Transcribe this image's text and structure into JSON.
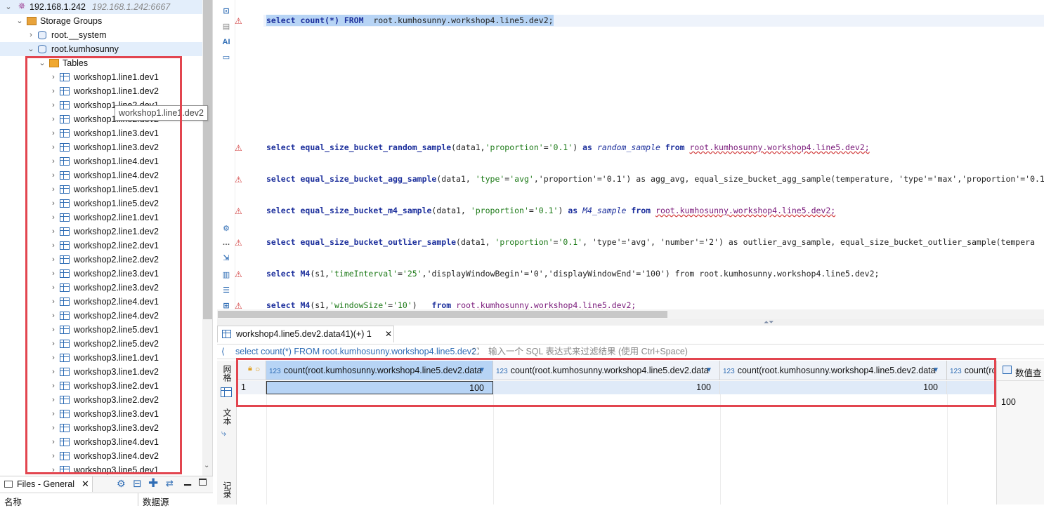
{
  "navigator": {
    "server_name": "192.168.1.242",
    "server_address": "192.168.1.242:6667",
    "storage_groups_label": "Storage Groups",
    "system_group": "root.__system",
    "db_group": "root.kumhosunny",
    "tables_label": "Tables",
    "tables": [
      "workshop1.line1.dev1",
      "workshop1.line1.dev2",
      "workshop1.line2.dev1",
      "workshop1.line2.dev2",
      "workshop1.line3.dev1",
      "workshop1.line3.dev2",
      "workshop1.line4.dev1",
      "workshop1.line4.dev2",
      "workshop1.line5.dev1",
      "workshop1.line5.dev2",
      "workshop2.line1.dev1",
      "workshop2.line1.dev2",
      "workshop2.line2.dev1",
      "workshop2.line2.dev2",
      "workshop2.line3.dev1",
      "workshop2.line3.dev2",
      "workshop2.line4.dev1",
      "workshop2.line4.dev2",
      "workshop2.line5.dev1",
      "workshop2.line5.dev2",
      "workshop3.line1.dev1",
      "workshop3.line1.dev2",
      "workshop3.line2.dev1",
      "workshop3.line2.dev2",
      "workshop3.line3.dev1",
      "workshop3.line3.dev2",
      "workshop3.line4.dev1",
      "workshop3.line4.dev2",
      "workshop3.line5.dev1"
    ],
    "tooltip": "workshop1.line1.dev2"
  },
  "files_panel": {
    "tab_label": "Files - General",
    "col_name": "名称",
    "col_datasource": "数据源"
  },
  "editor": {
    "gutter_ai_label": "AI",
    "line1": {
      "kw1": "select",
      "fn": "count(*)",
      "kw2": "FROM",
      "ref": "root.kumhosunny.workshop4.line5.dev2;"
    },
    "queries": [
      {
        "kw1": "select",
        "fn": "equal_size_bucket_random_sample",
        "args": "(data1,",
        "s1": "'proportion'",
        "eq": "=",
        "s2": "'0.1'",
        "close": ") ",
        "kw2": "as",
        "alias": "random_sample",
        "kw3": "from",
        "ref": "root.kumhosunny.workshop4.line5.dev2;",
        "rest": ""
      },
      {
        "kw1": "select",
        "fn": "equal_size_bucket_agg_sample",
        "args": "(data1, ",
        "s1": "'type'",
        "eq": "=",
        "s2": "'avg'",
        "close": ",",
        "kw2": "",
        "alias": "",
        "kw3": "",
        "ref": "",
        "rest": "'proportion'='0.1') as agg_avg, equal_size_bucket_agg_sample(temperature, 'type'='max','proportion'='0.1'"
      },
      {
        "kw1": "select",
        "fn": "equal_size_bucket_m4_sample",
        "args": "(data1, ",
        "s1": "'proportion'",
        "eq": "=",
        "s2": "'0.1'",
        "close": ") ",
        "kw2": "as",
        "alias": "M4_sample",
        "kw3": "from",
        "ref": "root.kumhosunny.workshop4.line5.dev2;",
        "rest": ""
      },
      {
        "kw1": "select",
        "fn": "equal_size_bucket_outlier_sample",
        "args": "(data1, ",
        "s1": "'proportion'",
        "eq": "=",
        "s2": "'0.1'",
        "close": ", ",
        "kw2": "",
        "alias": "",
        "kw3": "",
        "ref": "",
        "rest": "'type'='avg', 'number'='2') as outlier_avg_sample, equal_size_bucket_outlier_sample(tempera"
      },
      {
        "kw1": "select",
        "fn": "M4",
        "args": "(s1,",
        "s1": "'timeInterval'",
        "eq": "=",
        "s2": "'25'",
        "close": ",",
        "kw2": "",
        "alias": "",
        "kw3": "",
        "ref": "",
        "rest": "'displayWindowBegin'='0','displayWindowEnd'='100') from root.kumhosunny.workshop4.line5.dev2;"
      },
      {
        "kw1": "select",
        "fn": "M4",
        "args": "(s1,",
        "s1": "'windowSize'",
        "eq": "=",
        "s2": "'10'",
        "close": ") ",
        "kw2": "",
        "alias": "",
        "kw3": "from",
        "ref": "root.kumhosunny.workshop4.line5.dev2;",
        "rest": ""
      }
    ]
  },
  "results": {
    "tab_label": "workshop4.line5.dev2.data41)(+) 1",
    "filter_sql": "select count(*) FROM root.kumhosunny.workshop4.line5.dev2",
    "filter_placeholder": "输入一个 SQL 表达式来过滤结果 (使用 Ctrl+Space)",
    "side_labels": [
      "网格",
      "文本",
      "记录"
    ],
    "type_badge": "123",
    "columns": [
      "count(root.kumhosunny.workshop4.line5.dev2.data",
      "count(root.kumhosunny.workshop4.line5.dev2.data",
      "count(root.kumhosunny.workshop4.line5.dev2.data",
      "count(ro"
    ],
    "row_number": "1",
    "row_values": [
      "100",
      "100",
      "100"
    ],
    "value_panel_title": "数值查",
    "value_panel_value": "100"
  },
  "colors": {
    "highlight_border": "#e2454f",
    "selection": "#b7d4f5",
    "keyword": "#1c2f9c",
    "string": "#1d7a18"
  }
}
